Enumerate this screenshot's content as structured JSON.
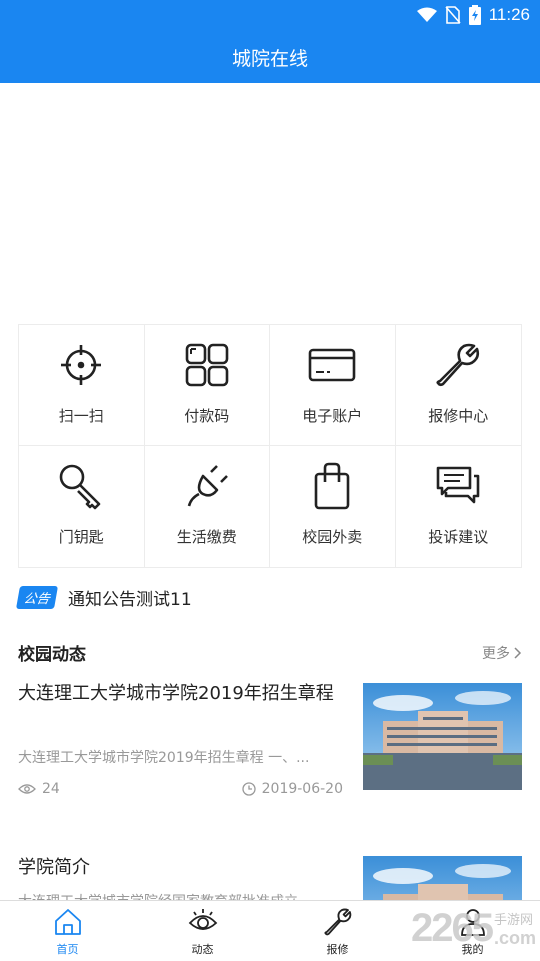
{
  "status_bar": {
    "time": "11:26"
  },
  "header": {
    "title": "城院在线"
  },
  "services": [
    {
      "label": "扫一扫",
      "icon": "scan-icon"
    },
    {
      "label": "付款码",
      "icon": "grid-code-icon"
    },
    {
      "label": "电子账户",
      "icon": "card-icon"
    },
    {
      "label": "报修中心",
      "icon": "wrench-icon"
    },
    {
      "label": "门钥匙",
      "icon": "key-icon"
    },
    {
      "label": "生活缴费",
      "icon": "plug-icon"
    },
    {
      "label": "校园外卖",
      "icon": "bag-icon"
    },
    {
      "label": "投诉建议",
      "icon": "chat-icon"
    }
  ],
  "notice": {
    "tag": "公告",
    "text": "通知公告测试11"
  },
  "campus_news": {
    "title": "校园动态",
    "more": "更多",
    "items": [
      {
        "title": "大连理工大学城市学院2019年招生章程",
        "summary": "大连理工大学城市学院2019年招生章程 一、...",
        "views": "24",
        "date": "2019-06-20"
      },
      {
        "title": "学院简介",
        "summary": "大连理工大学城市学院经国家教育部批准成立"
      }
    ]
  },
  "tabbar": [
    {
      "label": "首页",
      "icon": "home-icon"
    },
    {
      "label": "动态",
      "icon": "eye-icon"
    },
    {
      "label": "报修",
      "icon": "wrench-icon"
    },
    {
      "label": "我的",
      "icon": "user-icon"
    }
  ],
  "watermark": {
    "number": "2265",
    "site": "手游网",
    "domain": ".com"
  },
  "colors": {
    "primary": "#1a86f1",
    "text": "#222222",
    "muted": "#999999"
  }
}
